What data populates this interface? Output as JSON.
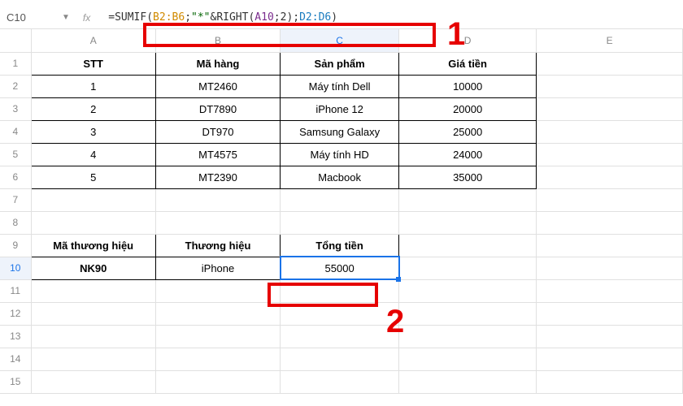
{
  "formulaBar": {
    "cellRef": "C10",
    "fx": "fx",
    "formula": {
      "eq": "=",
      "fn": "SUMIF",
      "open": "(",
      "r1": "B2:B6",
      "s1": ";",
      "str1": "\"*\"",
      "amp": "&",
      "fn2": "RIGHT",
      "open2": "(",
      "r2": "A10",
      "s2": ";",
      "lit": "2",
      "close2": ")",
      "s3": ";",
      "r3": "D2:D6",
      "close": ")"
    }
  },
  "columns": [
    "A",
    "B",
    "C",
    "D",
    "E"
  ],
  "rows": [
    "1",
    "2",
    "3",
    "4",
    "5",
    "6",
    "7",
    "8",
    "9",
    "10",
    "11",
    "12",
    "13",
    "14",
    "15"
  ],
  "table1": {
    "headers": {
      "A": "STT",
      "B": "Mã hàng",
      "C": "Sản phẩm",
      "D": "Giá tiền"
    },
    "rows": [
      {
        "A": "1",
        "B": "MT2460",
        "C": "Máy tính Dell",
        "D": "10000"
      },
      {
        "A": "2",
        "B": "DT7890",
        "C": "iPhone 12",
        "D": "20000"
      },
      {
        "A": "3",
        "B": "DT970",
        "C": "Samsung Galaxy",
        "D": "25000"
      },
      {
        "A": "4",
        "B": "MT4575",
        "C": "Máy tính HD",
        "D": "24000"
      },
      {
        "A": "5",
        "B": "MT2390",
        "C": "Macbook",
        "D": "35000"
      }
    ]
  },
  "table2": {
    "headers": {
      "A": "Mã thương hiệu",
      "B": "Thương hiệu",
      "C": "Tổng tiền"
    },
    "row": {
      "A": "NK90",
      "B": "iPhone",
      "C": "55000"
    }
  },
  "annotations": {
    "one": "1",
    "two": "2"
  }
}
